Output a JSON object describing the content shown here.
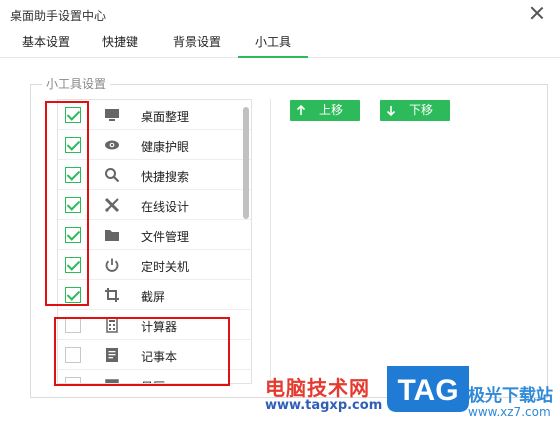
{
  "window": {
    "title": "桌面助手设置中心"
  },
  "tabs": [
    {
      "label": "基本设置",
      "active": false
    },
    {
      "label": "快捷键",
      "active": false
    },
    {
      "label": "背景设置",
      "active": false
    },
    {
      "label": "小工具",
      "active": true
    }
  ],
  "group": {
    "legend": "小工具设置"
  },
  "tools": [
    {
      "label": "桌面整理",
      "icon": "monitor-icon",
      "checked": true
    },
    {
      "label": "健康护眼",
      "icon": "eye-icon",
      "checked": true
    },
    {
      "label": "快捷搜索",
      "icon": "search-icon",
      "checked": true
    },
    {
      "label": "在线设计",
      "icon": "design-tools-icon",
      "checked": true
    },
    {
      "label": "文件管理",
      "icon": "folder-icon",
      "checked": true
    },
    {
      "label": "定时关机",
      "icon": "power-icon",
      "checked": true
    },
    {
      "label": "截屏",
      "icon": "crop-icon",
      "checked": true
    },
    {
      "label": "计算器",
      "icon": "calculator-icon",
      "checked": false
    },
    {
      "label": "记事本",
      "icon": "notepad-icon",
      "checked": false
    },
    {
      "label": "日历",
      "icon": "calendar-icon",
      "checked": false
    }
  ],
  "buttons": {
    "move_up": "上移",
    "move_down": "下移"
  },
  "colors": {
    "accent": "#2dba5a",
    "highlight": "#e01010"
  },
  "watermark": {
    "brand": "电脑技术网",
    "url": "www.tagxp.com",
    "logo": "TAG",
    "site": "极光下载站",
    "site_url": "www.xz7.com"
  }
}
